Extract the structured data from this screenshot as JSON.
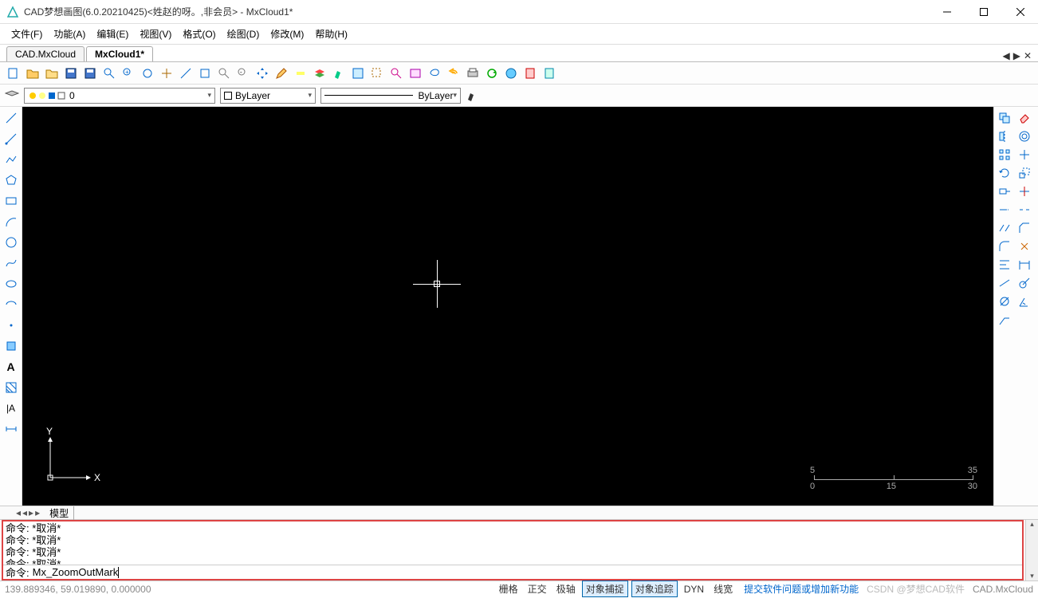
{
  "title": "CAD梦想画图(6.0.20210425)<姓赵的呀。,非会员> - MxCloud1*",
  "menu": [
    "文件(F)",
    "功能(A)",
    "编辑(E)",
    "视图(V)",
    "格式(O)",
    "绘图(D)",
    "修改(M)",
    "帮助(H)"
  ],
  "tabs": [
    {
      "label": "CAD.MxCloud",
      "active": false
    },
    {
      "label": "MxCloud1*",
      "active": true
    }
  ],
  "layer": {
    "current": "0",
    "bylayer1": "ByLayer",
    "bylayer2": "ByLayer"
  },
  "ucs": {
    "x": "X",
    "y": "Y"
  },
  "scale": {
    "a": "5",
    "b": "35",
    "c": "0",
    "d": "15",
    "e": "30"
  },
  "modeltab": "模型",
  "cmd": {
    "hist": [
      "命令:  *取消*",
      "命令:  *取消*",
      "命令:  *取消*",
      "命令:  *取消*"
    ],
    "prompt": "命令:",
    "input": "Mx_ZoomOutMark"
  },
  "status": {
    "coords": "139.889346,  59.019890,  0.000000",
    "btns": [
      "栅格",
      "正交",
      "极轴",
      "对象捕捉",
      "对象追踪",
      "DYN",
      "线宽"
    ],
    "active": [
      false,
      false,
      false,
      true,
      true,
      false,
      false
    ],
    "link": "提交软件问题或增加新功能",
    "wm": "CSDN @梦想CAD软件",
    "brand": "CAD.MxCloud"
  }
}
